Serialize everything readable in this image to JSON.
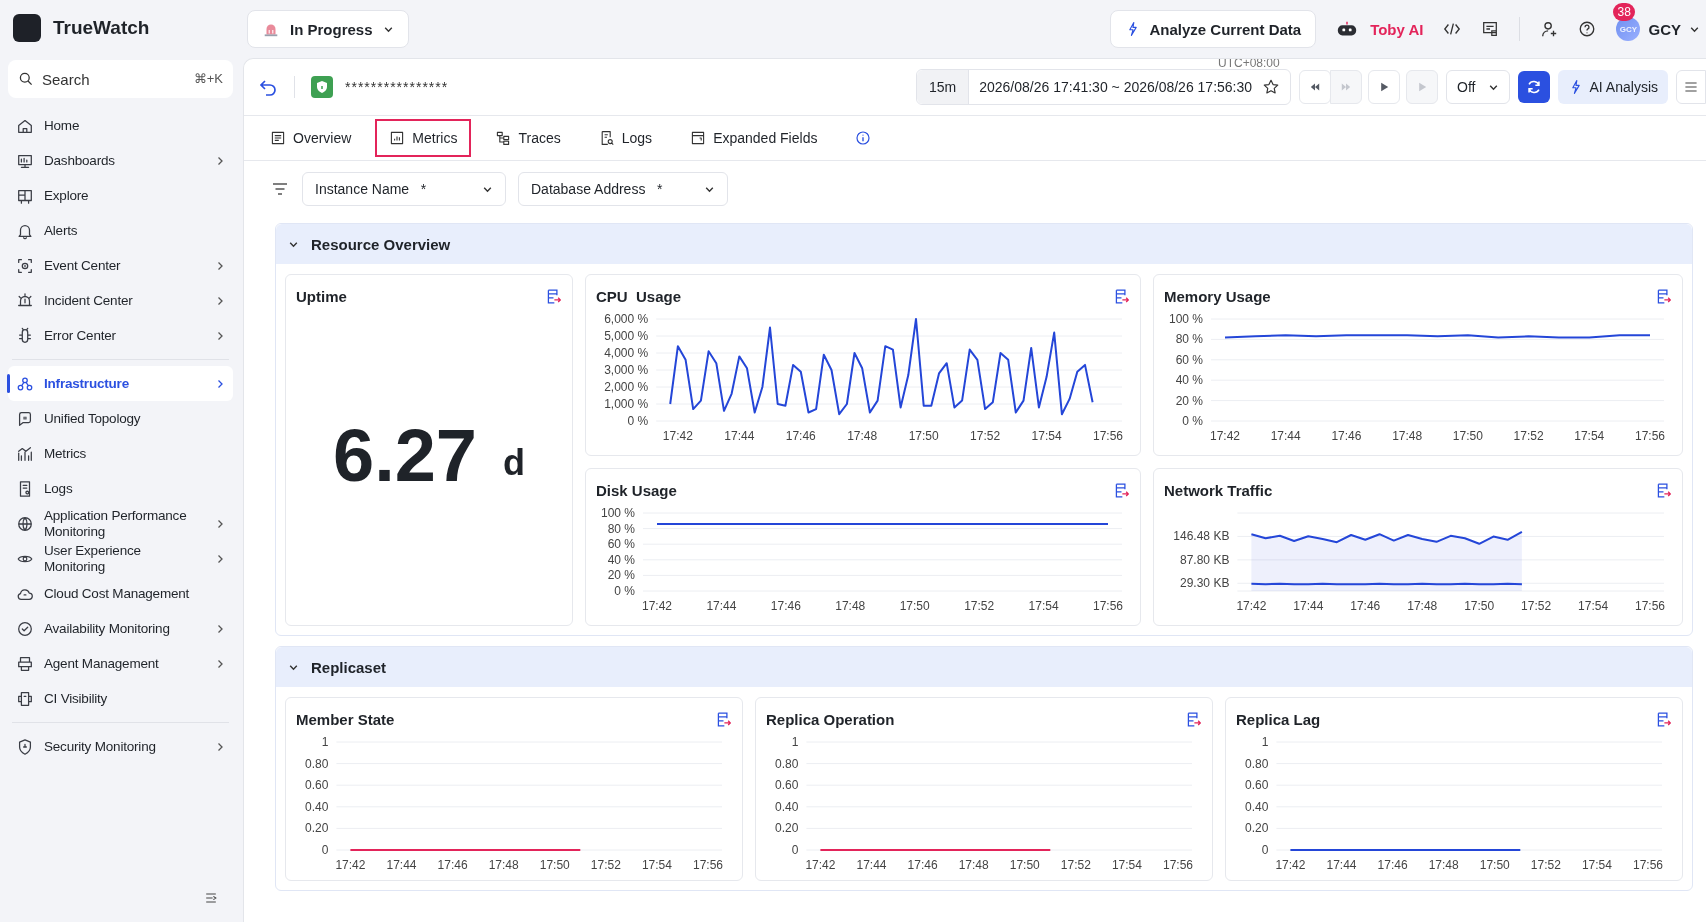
{
  "app": {
    "name": "TrueWatch"
  },
  "status_dropdown": {
    "label": "In Progress"
  },
  "topbar": {
    "analyze_button": "Analyze Current Data",
    "assistant": "Toby AI",
    "notifications": "38",
    "avatar_initials": "GCY",
    "user": "GCY"
  },
  "search": {
    "placeholder": "Search",
    "shortcut": "⌘+K"
  },
  "sidebar": {
    "groups": [
      {
        "items": [
          {
            "label": "Home",
            "selected": false,
            "expandable": false
          },
          {
            "label": "Dashboards",
            "selected": false,
            "expandable": true
          },
          {
            "label": "Explore",
            "selected": false,
            "expandable": false
          },
          {
            "label": "Alerts",
            "selected": false,
            "expandable": false
          },
          {
            "label": "Event Center",
            "selected": false,
            "expandable": true
          },
          {
            "label": "Incident Center",
            "selected": false,
            "expandable": true
          },
          {
            "label": "Error Center",
            "selected": false,
            "expandable": true
          }
        ]
      },
      {
        "items": [
          {
            "label": "Infrastructure",
            "selected": true,
            "expandable": true
          },
          {
            "label": "Unified Topology",
            "selected": false,
            "expandable": false
          },
          {
            "label": "Metrics",
            "selected": false,
            "expandable": false
          },
          {
            "label": "Logs",
            "selected": false,
            "expandable": false
          },
          {
            "label": "Application Performance Monitoring",
            "selected": false,
            "expandable": true
          },
          {
            "label": "User Experience Monitoring",
            "selected": false,
            "expandable": true
          },
          {
            "label": "Cloud Cost Management",
            "selected": false,
            "expandable": false
          },
          {
            "label": "Availability Monitoring",
            "selected": false,
            "expandable": true
          },
          {
            "label": "Agent Management",
            "selected": false,
            "expandable": true
          },
          {
            "label": "CI Visibility",
            "selected": false,
            "expandable": false
          }
        ]
      },
      {
        "items": [
          {
            "label": "Security Monitoring",
            "selected": false,
            "expandable": true
          }
        ]
      }
    ]
  },
  "header": {
    "title": "****************",
    "timezone": "UTC+08:00",
    "range_preset": "15m",
    "time_range": "2026/08/26 17:41:30 ~ 2026/08/26 17:56:30",
    "playback": [
      {
        "kind": "rewind",
        "disabled": false
      },
      {
        "kind": "forward",
        "disabled": true
      },
      {
        "kind": "play",
        "disabled": false
      },
      {
        "kind": "step",
        "disabled": true
      }
    ],
    "auto_refresh": "Off",
    "ai_button": "AI Analysis"
  },
  "tabs": [
    {
      "label": "Overview",
      "selected": false
    },
    {
      "label": "Metrics",
      "selected": true
    },
    {
      "label": "Traces",
      "selected": false
    },
    {
      "label": "Logs",
      "selected": false
    },
    {
      "label": "Expanded Fields",
      "selected": false
    }
  ],
  "filters": [
    {
      "label": "Instance Name",
      "value": "*"
    },
    {
      "label": "Database Address",
      "value": "*"
    }
  ],
  "sections": [
    {
      "title": "Resource Overview",
      "expanded": true,
      "panels": [
        {
          "kind": "stat",
          "title": "Uptime",
          "value": "6.27",
          "unit": "d"
        },
        {
          "kind": "chart",
          "title": "CPU  Usage",
          "chart_data": {
            "type": "line",
            "grid": true,
            "ylim": [
              0,
              6000
            ],
            "yticks": [
              {
                "value": 0,
                "label": "0 %"
              },
              {
                "value": 1000,
                "label": "1,000 %"
              },
              {
                "value": 2000,
                "label": "2,000 %"
              },
              {
                "value": 3000,
                "label": "3,000 %"
              },
              {
                "value": 4000,
                "label": "4,000 %"
              },
              {
                "value": 5000,
                "label": "5,000 %"
              },
              {
                "value": 6000,
                "label": "6,000 %"
              }
            ],
            "categories": [
              null,
              "17:42",
              null,
              null,
              null,
              null,
              null,
              null,
              null,
              "17:44",
              null,
              null,
              null,
              null,
              null,
              null,
              null,
              "17:46",
              null,
              null,
              null,
              null,
              null,
              null,
              null,
              "17:48",
              null,
              null,
              null,
              null,
              null,
              null,
              null,
              "17:50",
              null,
              null,
              null,
              null,
              null,
              null,
              null,
              "17:52",
              null,
              null,
              null,
              null,
              null,
              null,
              null,
              "17:54",
              null,
              null,
              null,
              null,
              null,
              null,
              null,
              "17:56"
            ],
            "series": [
              {
                "color": "#2446d8",
                "values": [
                  1000,
                  4400,
                  3600,
                  700,
                  1200,
                  4100,
                  3400,
                  600,
                  1600,
                  3800,
                  3100,
                  500,
                  2000,
                  5500,
                  1000,
                  900,
                  3300,
                  2900,
                  500,
                  700,
                  3900,
                  3000,
                  400,
                  1000,
                  4000,
                  3100,
                  500,
                  1200,
                  4400,
                  4200,
                  800,
                  2700,
                  6000,
                  900,
                  900,
                  2800,
                  3400,
                  800,
                  1200,
                  4200,
                  3600,
                  700,
                  1100,
                  4000,
                  3600,
                  500,
                  1200,
                  4300,
                  800,
                  2600,
                  5200,
                  400,
                  1300,
                  2900,
                  3300,
                  1100,
                  null,
                  null
                ]
              }
            ]
          }
        },
        {
          "kind": "chart",
          "title": "Memory Usage",
          "chart_data": {
            "type": "line",
            "grid": true,
            "ylim": [
              0,
              100
            ],
            "yticks": [
              {
                "value": 0,
                "label": "0 %"
              },
              {
                "value": 20,
                "label": "20 %"
              },
              {
                "value": 40,
                "label": "40 %"
              },
              {
                "value": 60,
                "label": "60 %"
              },
              {
                "value": 80,
                "label": "80 %"
              },
              {
                "value": 100,
                "label": "100 %"
              }
            ],
            "categories": [
              "17:42",
              null,
              "17:44",
              null,
              "17:46",
              null,
              "17:48",
              null,
              "17:50",
              null,
              "17:52",
              null,
              "17:54",
              null,
              "17:56"
            ],
            "series": [
              {
                "color": "#2446d8",
                "values": [
                  82,
                  83,
                  84,
                  83,
                  84,
                  84,
                  84,
                  83,
                  84,
                  82,
                  83,
                  82,
                  82,
                  84,
                  84
                ]
              }
            ]
          }
        },
        {
          "kind": "chart",
          "title": "Disk Usage",
          "chart_data": {
            "type": "line",
            "grid": true,
            "ylim": [
              0,
              100
            ],
            "yticks": [
              {
                "value": 0,
                "label": "0 %"
              },
              {
                "value": 20,
                "label": "20 %"
              },
              {
                "value": 40,
                "label": "40 %"
              },
              {
                "value": 60,
                "label": "60 %"
              },
              {
                "value": 80,
                "label": "80 %"
              },
              {
                "value": 100,
                "label": "100 %"
              }
            ],
            "categories": [
              "17:42",
              null,
              "17:44",
              null,
              "17:46",
              null,
              "17:48",
              null,
              "17:50",
              null,
              "17:52",
              null,
              "17:54",
              null,
              "17:56"
            ],
            "series": [
              {
                "color": "#2446d8",
                "values": [
                  86,
                  86,
                  86,
                  86,
                  86,
                  86,
                  86,
                  86,
                  86,
                  86,
                  86,
                  86,
                  86,
                  86,
                  86
                ]
              }
            ]
          }
        },
        {
          "kind": "chart",
          "title": "Network Traffic",
          "chart_data": {
            "type": "area",
            "grid": true,
            "ylim": [
              10,
              205
            ],
            "yticks": [
              {
                "value": 29.3,
                "label": "29.30 KB"
              },
              {
                "value": 87.8,
                "label": "87.80 KB"
              },
              {
                "value": 146.48,
                "label": "146.48 KB"
              }
            ],
            "categories": [
              "17:42",
              null,
              null,
              null,
              "17:44",
              null,
              null,
              null,
              "17:46",
              null,
              null,
              null,
              "17:48",
              null,
              null,
              null,
              "17:50",
              null,
              null,
              null,
              "17:52",
              null,
              null,
              null,
              "17:54",
              null,
              null,
              null,
              "17:56"
            ],
            "series": [
              {
                "color": "#2446d8",
                "values": [
                  152,
                  142,
                  148,
                  135,
                  147,
                  140,
                  132,
                  150,
                  138,
                  152,
                  136,
                  150,
                  140,
                  133,
                  148,
                  142,
                  128,
                  146,
                  138,
                  158,
                  null,
                  null,
                  null,
                  null,
                  null,
                  null,
                  null,
                  null,
                  null
                ]
              },
              {
                "type": "line",
                "color": "#2446d8",
                "values": [
                  28,
                  27,
                  28,
                  27,
                  27,
                  28,
                  27,
                  27,
                  27,
                  28,
                  27,
                  27,
                  28,
                  27,
                  27,
                  28,
                  27,
                  27,
                  28,
                  27,
                  null,
                  null,
                  null,
                  null,
                  null,
                  null,
                  null,
                  null,
                  null
                ]
              }
            ]
          }
        }
      ]
    },
    {
      "title": "Replicaset",
      "expanded": true,
      "panels": [
        {
          "kind": "chart",
          "title": "Member State",
          "chart_data": {
            "type": "line",
            "grid": true,
            "ylim": [
              0,
              1
            ],
            "yticks": [
              {
                "value": 0,
                "label": "0"
              },
              {
                "value": 0.2,
                "label": "0.20"
              },
              {
                "value": 0.4,
                "label": "0.40"
              },
              {
                "value": 0.6,
                "label": "0.60"
              },
              {
                "value": 0.8,
                "label": "0.80"
              },
              {
                "value": 1,
                "label": "1"
              }
            ],
            "categories": [
              "17:42",
              null,
              "17:44",
              null,
              "17:46",
              null,
              "17:48",
              null,
              "17:50",
              null,
              "17:52",
              null,
              "17:54",
              null,
              "17:56"
            ],
            "series": [
              {
                "color": "#e3245a",
                "values": [
                  0,
                  0,
                  0,
                  0,
                  0,
                  0,
                  0,
                  0,
                  0,
                  0,
                  null,
                  null,
                  null,
                  null,
                  null
                ]
              }
            ]
          }
        },
        {
          "kind": "chart",
          "title": "Replica Operation",
          "chart_data": {
            "type": "line",
            "grid": true,
            "ylim": [
              0,
              1
            ],
            "yticks": [
              {
                "value": 0,
                "label": "0"
              },
              {
                "value": 0.2,
                "label": "0.20"
              },
              {
                "value": 0.4,
                "label": "0.40"
              },
              {
                "value": 0.6,
                "label": "0.60"
              },
              {
                "value": 0.8,
                "label": "0.80"
              },
              {
                "value": 1,
                "label": "1"
              }
            ],
            "categories": [
              "17:42",
              null,
              "17:44",
              null,
              "17:46",
              null,
              "17:48",
              null,
              "17:50",
              null,
              "17:52",
              null,
              "17:54",
              null,
              "17:56"
            ],
            "series": [
              {
                "color": "#e3245a",
                "values": [
                  0,
                  0,
                  0,
                  0,
                  0,
                  0,
                  0,
                  0,
                  0,
                  0,
                  null,
                  null,
                  null,
                  null,
                  null
                ]
              }
            ]
          }
        },
        {
          "kind": "chart",
          "title": "Replica Lag",
          "chart_data": {
            "type": "line",
            "grid": true,
            "ylim": [
              0,
              1
            ],
            "yticks": [
              {
                "value": 0,
                "label": "0"
              },
              {
                "value": 0.2,
                "label": "0.20"
              },
              {
                "value": 0.4,
                "label": "0.40"
              },
              {
                "value": 0.6,
                "label": "0.60"
              },
              {
                "value": 0.8,
                "label": "0.80"
              },
              {
                "value": 1,
                "label": "1"
              }
            ],
            "categories": [
              "17:42",
              null,
              "17:44",
              null,
              "17:46",
              null,
              "17:48",
              null,
              "17:50",
              null,
              "17:52",
              null,
              "17:54",
              null,
              "17:56"
            ],
            "series": [
              {
                "color": "#2446d8",
                "values": [
                  0,
                  0,
                  0,
                  0,
                  0,
                  0,
                  0,
                  0,
                  0,
                  0,
                  null,
                  null,
                  null,
                  null,
                  null
                ]
              }
            ]
          }
        }
      ]
    }
  ]
}
